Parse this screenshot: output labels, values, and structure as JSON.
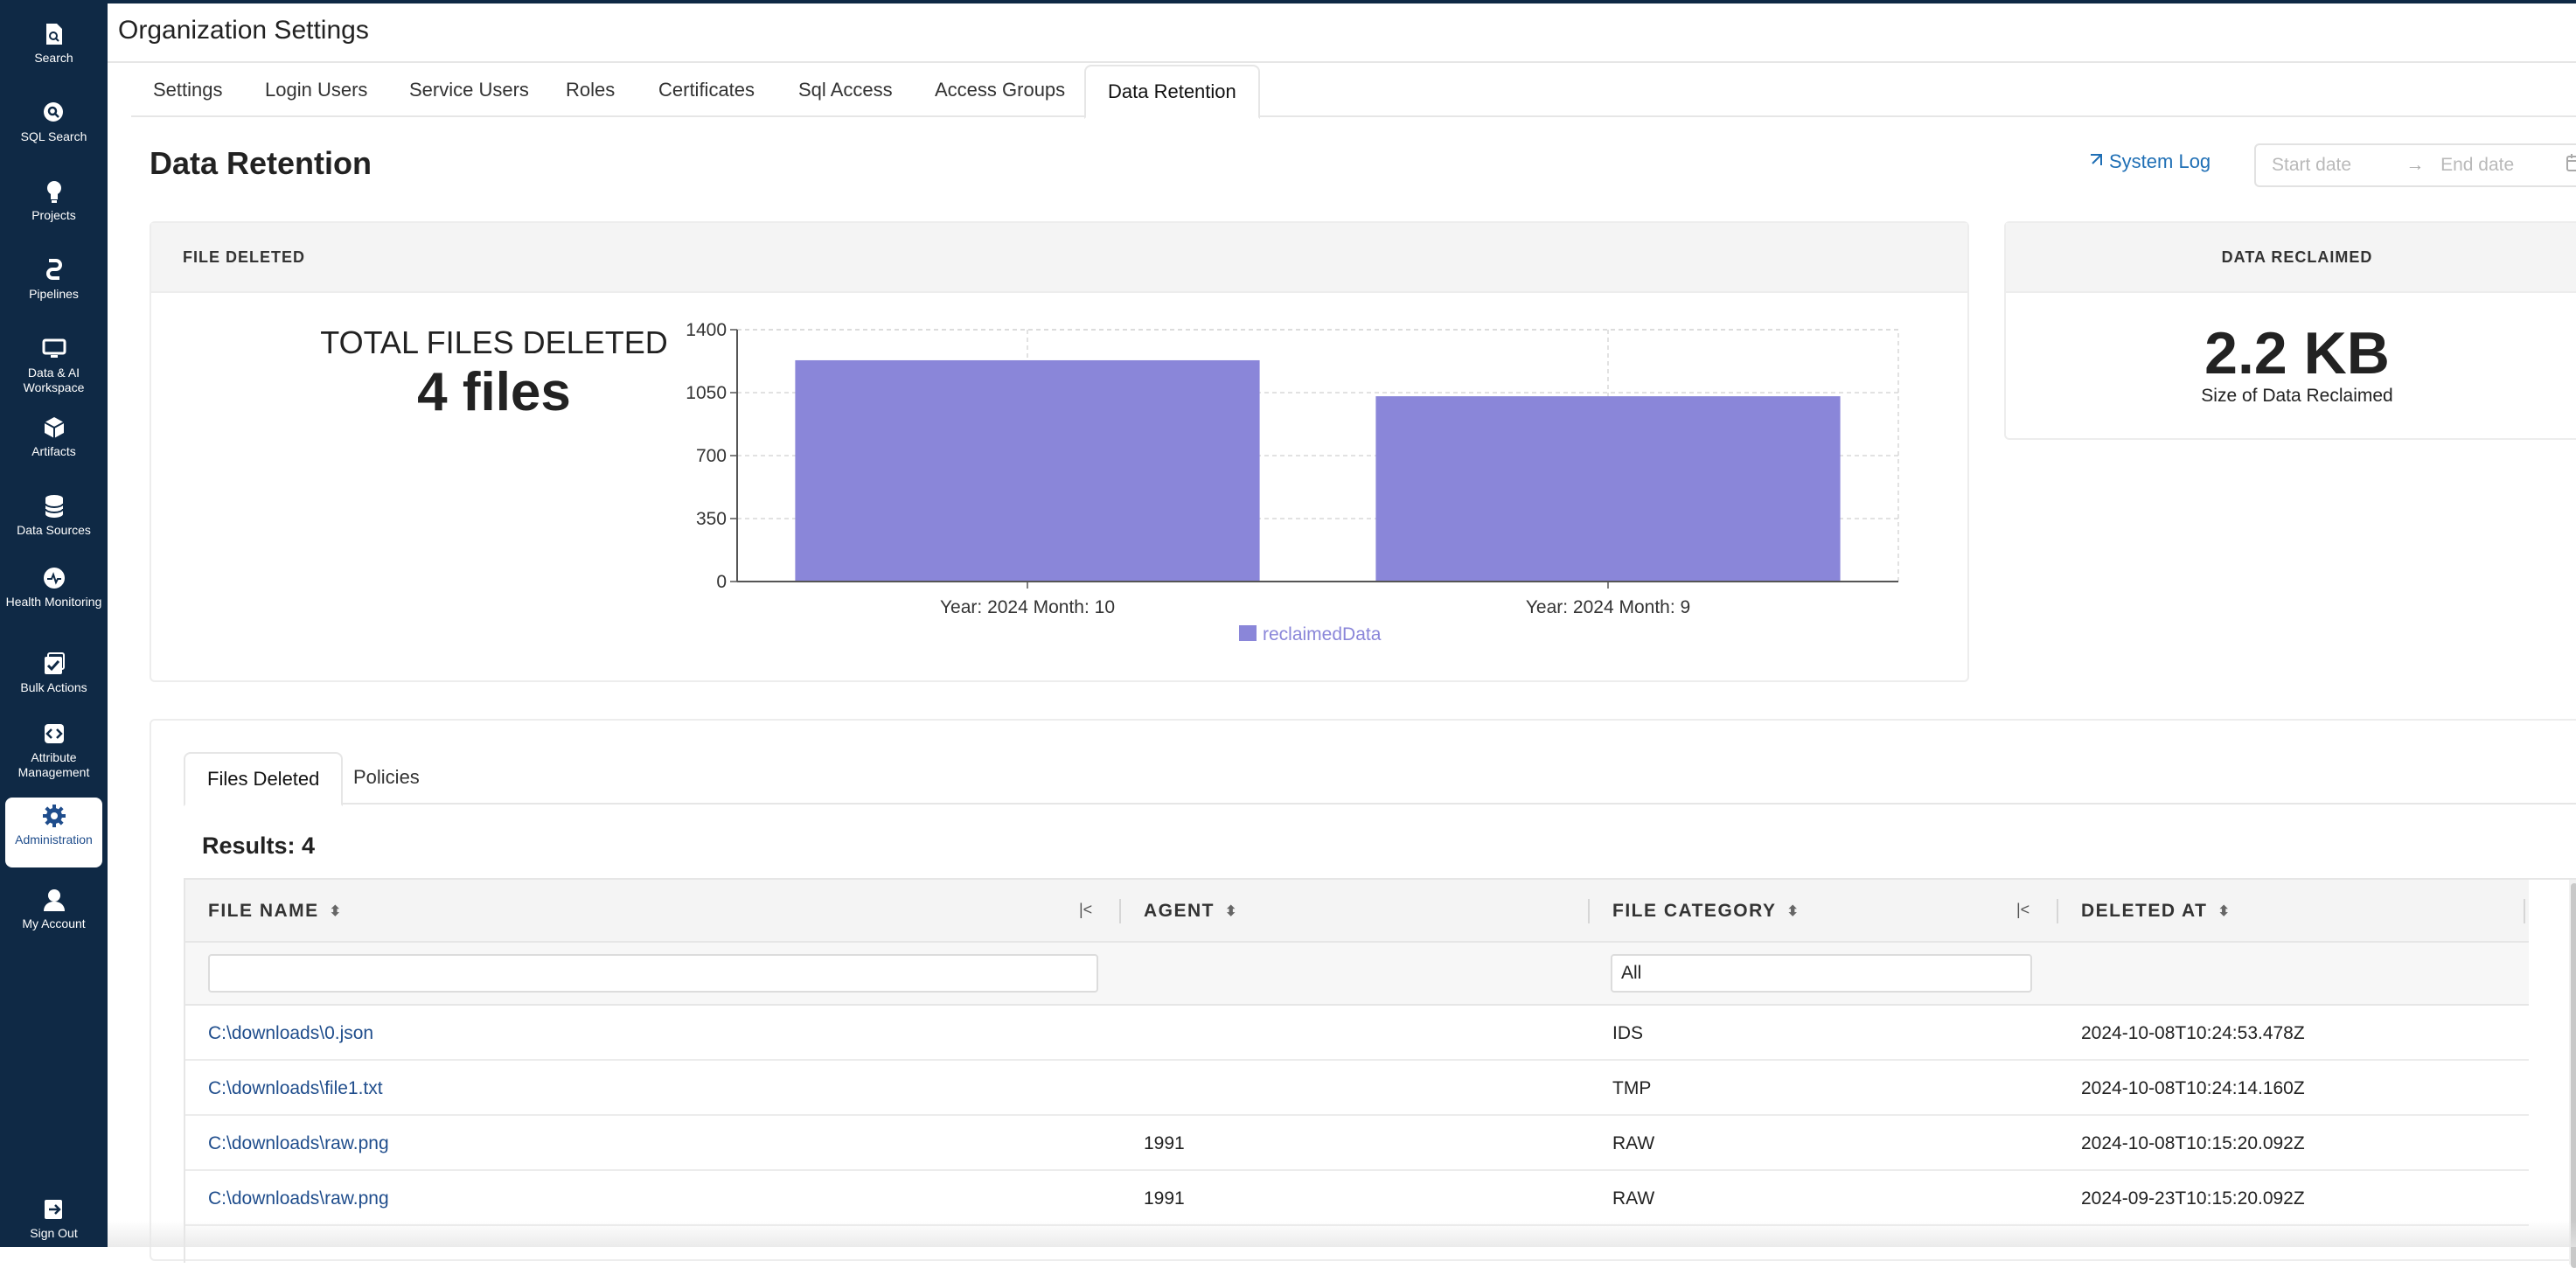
{
  "sidebar": {
    "items": [
      {
        "label": "Search",
        "icon": "search-doc-icon"
      },
      {
        "label": "SQL Search",
        "icon": "sql-search-icon"
      },
      {
        "label": "Projects",
        "icon": "lightbulb-icon"
      },
      {
        "label": "Pipelines",
        "icon": "pipeline-icon"
      },
      {
        "label": "Data & AI Workspace",
        "icon": "monitor-icon"
      },
      {
        "label": "Artifacts",
        "icon": "cube-icon"
      },
      {
        "label": "Data Sources",
        "icon": "database-icon"
      },
      {
        "label": "Health Monitoring",
        "icon": "health-icon"
      },
      {
        "label": "Bulk Actions",
        "icon": "bulk-check-icon"
      },
      {
        "label": "Attribute Management",
        "icon": "code-icon"
      },
      {
        "label": "Administration",
        "icon": "gear-icon"
      },
      {
        "label": "My Account",
        "icon": "user-icon"
      }
    ],
    "signout": {
      "label": "Sign Out",
      "icon": "sign-out-icon"
    }
  },
  "header": {
    "title": "Organization Settings"
  },
  "tabs": [
    "Settings",
    "Login Users",
    "Service Users",
    "Roles",
    "Certificates",
    "Sql Access",
    "Access Groups",
    "Data Retention"
  ],
  "active_tab": "Data Retention",
  "section": {
    "title": "Data Retention",
    "system_log": "System Log",
    "date_start_placeholder": "Start date",
    "date_end_placeholder": "End date"
  },
  "files_card": {
    "header": "FILE DELETED",
    "total_label": "TOTAL FILES DELETED",
    "total_value": "4 files"
  },
  "reclaimed_card": {
    "header": "DATA RECLAIMED",
    "value": "2.2 KB",
    "sublabel": "Size of Data Reclaimed"
  },
  "chart_data": {
    "type": "bar",
    "categories": [
      "Year: 2024 Month: 10",
      "Year: 2024 Month: 9"
    ],
    "series": [
      {
        "name": "reclaimedData",
        "values": [
          1230,
          1030
        ]
      }
    ],
    "ylim": [
      0,
      1400
    ],
    "yticks": [
      0,
      350,
      700,
      1050,
      1400
    ],
    "grid": true,
    "legend": "bottom",
    "color": "#8a86d9"
  },
  "lower": {
    "subtabs": [
      "Files Deleted",
      "Policies"
    ],
    "active_subtab": "Files Deleted",
    "results_label": "Results: 4",
    "columns": [
      "FILE NAME",
      "AGENT",
      "FILE CATEGORY",
      "DELETED AT"
    ],
    "filters": {
      "file_name": "",
      "file_category": "All"
    },
    "rows": [
      {
        "file_name": "C:\\downloads\\0.json",
        "agent": "",
        "category": "IDS",
        "deleted_at": "2024-10-08T10:24:53.478Z"
      },
      {
        "file_name": "C:\\downloads\\file1.txt",
        "agent": "",
        "category": "TMP",
        "deleted_at": "2024-10-08T10:24:14.160Z"
      },
      {
        "file_name": "C:\\downloads\\raw.png",
        "agent": "1991",
        "category": "RAW",
        "deleted_at": "2024-10-08T10:15:20.092Z"
      },
      {
        "file_name": "C:\\downloads\\raw.png",
        "agent": "1991",
        "category": "RAW",
        "deleted_at": "2024-09-23T10:15:20.092Z"
      }
    ]
  },
  "colors": {
    "sidebar": "#0f2945",
    "link": "#1f4d8c",
    "accent": "#1f6fb5",
    "bar": "#8a86d9"
  }
}
